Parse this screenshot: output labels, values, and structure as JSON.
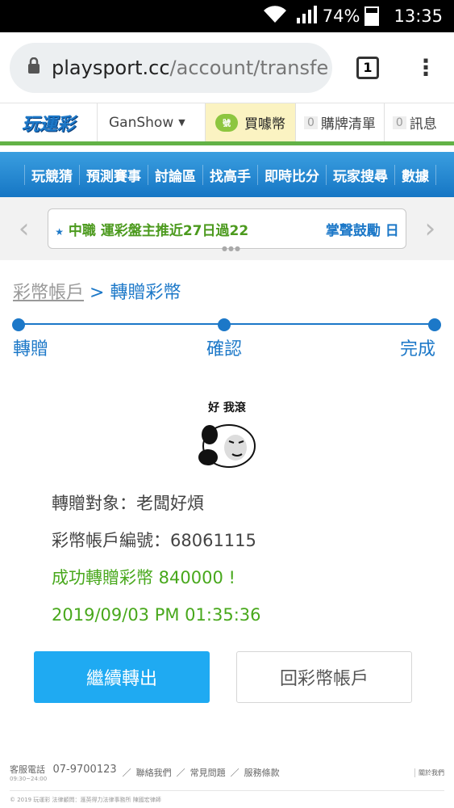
{
  "statusbar": {
    "battery": "74%",
    "time": "13:35"
  },
  "browser": {
    "url_host": "playsport.cc",
    "url_path": "/account/transfe",
    "tab_count": "1"
  },
  "header": {
    "logo": "玩運彩",
    "user": "GanShow",
    "buy_coin_icon": "號",
    "buy_coins": "買噱幣",
    "watchlist_count": "0",
    "watchlist": "購牌清單",
    "messages_count": "0",
    "messages": "訊息"
  },
  "nav": {
    "items": [
      "玩競猜",
      "預測賽事",
      "討論區",
      "找高手",
      "即時比分",
      "玩家搜尋",
      "數據"
    ]
  },
  "ticker": {
    "left": "中職 運彩盤主推近27日過22",
    "right": "掌聲鼓勵 日"
  },
  "breadcrumb": {
    "parent": "彩幣帳戶",
    "sep": ">",
    "current": "轉贈彩幣"
  },
  "steps": [
    "轉贈",
    "確認",
    "完成"
  ],
  "sticker": {
    "caption": "好 我滾"
  },
  "result": {
    "recipient": "轉贈對象：老闆好煩",
    "account": "彩幣帳戶編號：68061115",
    "success": "成功轉贈彩幣 840000 !",
    "timestamp": "2019/09/03 PM 01:35:36"
  },
  "buttons": {
    "continue": "繼續轉出",
    "back": "回彩幣帳戶"
  },
  "footer": {
    "service_label": "客服電話",
    "phone": "07-9700123",
    "hours": "09:30~24:00",
    "links": [
      "聯絡我們",
      "常見問題",
      "服務條款"
    ],
    "right": "關於我們",
    "copyright": "© 2019 玩運彩 法律顧問：滙英得力法律事務所 陳國宏律師"
  },
  "colors": {
    "brand_blue": "#1c78c8",
    "success_green": "#48a81c",
    "primary_button": "#1faaf2",
    "header_green": "#62b246"
  }
}
